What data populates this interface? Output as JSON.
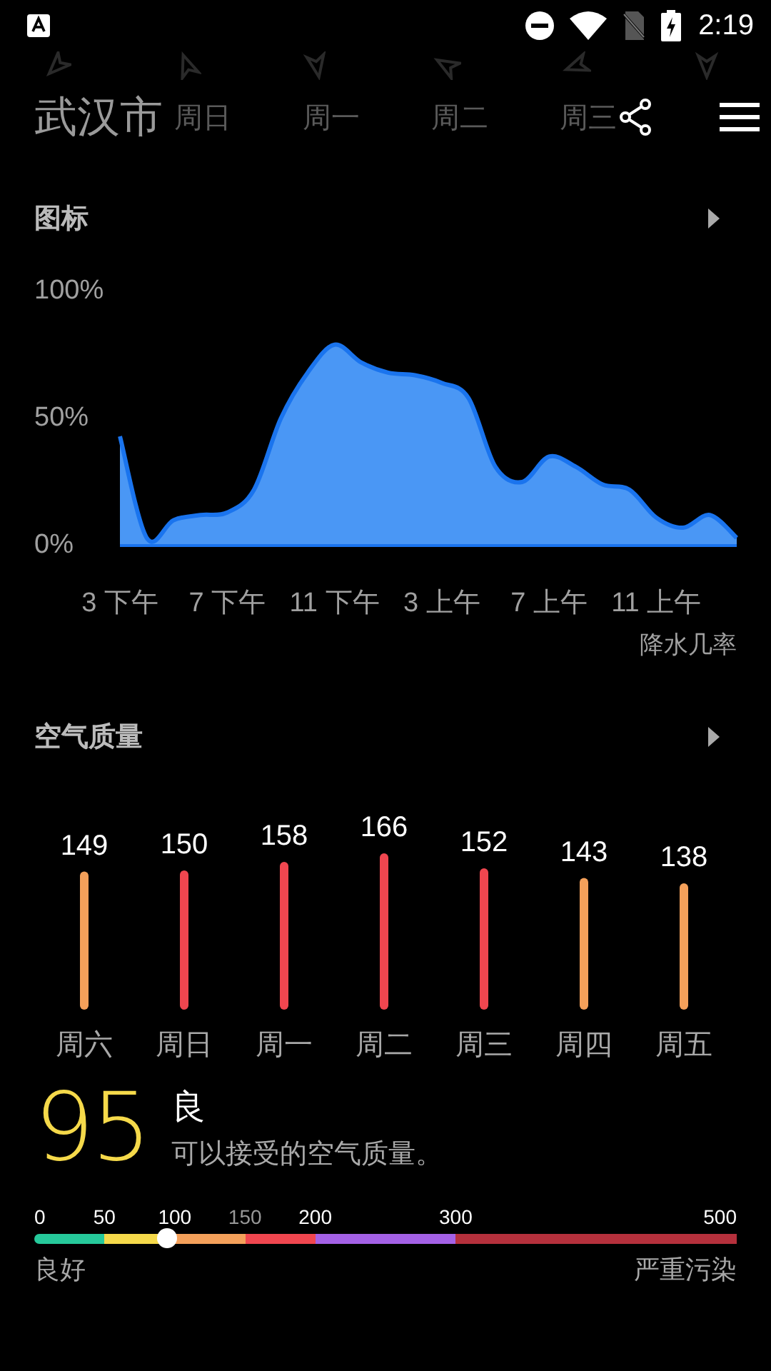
{
  "status_bar": {
    "time": "2:19"
  },
  "header": {
    "title": "武汉市",
    "days": [
      "周日",
      "周一",
      "周二",
      "周三"
    ]
  },
  "precip_section": {
    "title": "图标",
    "chart_data": {
      "type": "area",
      "xlabel": "降水几率",
      "categories": [
        "3 下午",
        null,
        null,
        null,
        "7 下午",
        null,
        null,
        null,
        "11 下午",
        null,
        null,
        null,
        "3 上午",
        null,
        null,
        null,
        "7 上午",
        null,
        null,
        null,
        "11 上午",
        null,
        null,
        null
      ],
      "series": [
        {
          "color": "#4a97f5",
          "values": [
            43,
            3,
            10,
            12,
            13,
            22,
            50,
            68,
            79,
            72,
            68,
            67,
            64,
            58,
            31,
            25,
            35,
            31,
            24,
            22,
            11,
            7,
            12,
            3
          ]
        }
      ],
      "ylim": [
        0,
        100
      ],
      "yticks": [
        {
          "value": 0,
          "label": "0%"
        },
        {
          "value": 50,
          "label": "50%"
        },
        {
          "value": 100,
          "label": "100%"
        }
      ]
    }
  },
  "air_section": {
    "title": "空气质量",
    "chart_data": {
      "type": "bar",
      "categories": [
        "周六",
        "周日",
        "周一",
        "周二",
        "周三",
        "周四",
        "周五"
      ],
      "series": [
        {
          "color": "#f4a05a",
          "values": [
            149,
            null,
            null,
            null,
            null,
            143,
            138
          ]
        },
        {
          "color": "#f0464f",
          "values": [
            null,
            150,
            158,
            166,
            152,
            null,
            null
          ]
        }
      ],
      "data_labels": true
    }
  },
  "current": {
    "value": "95",
    "label": "良",
    "description": "可以接受的空气质量。",
    "scale": [
      {
        "label": "0",
        "dimmed": false,
        "color": "#26c99b"
      },
      {
        "label": "50",
        "dimmed": false,
        "color": "#f5d94a"
      },
      {
        "label": "100",
        "dimmed": false,
        "color": "#f4a05a"
      },
      {
        "label": "150",
        "dimmed": true,
        "color": "#f0464f"
      },
      {
        "label": "200",
        "dimmed": false,
        "color": "#a461e6"
      },
      {
        "label": "300",
        "dimmed": false,
        "color": "#b5303c"
      },
      {
        "label": "500",
        "dimmed": false
      }
    ],
    "low_label": "良好",
    "high_label": "严重污染"
  }
}
